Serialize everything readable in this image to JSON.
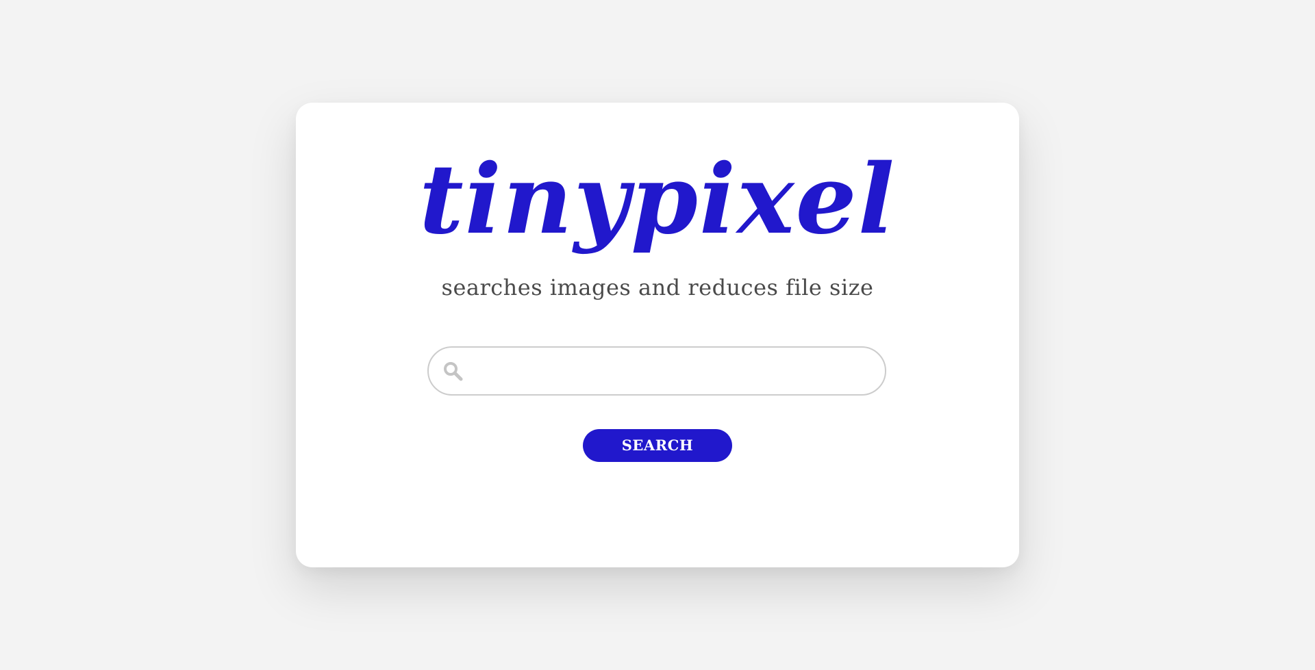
{
  "brand": {
    "name": "tinypixel",
    "tagline": "searches images and reduces file size",
    "accent_color": "#2118cc"
  },
  "search": {
    "value": "",
    "placeholder": "",
    "icon": "search-icon",
    "button_label": "SEARCH"
  }
}
